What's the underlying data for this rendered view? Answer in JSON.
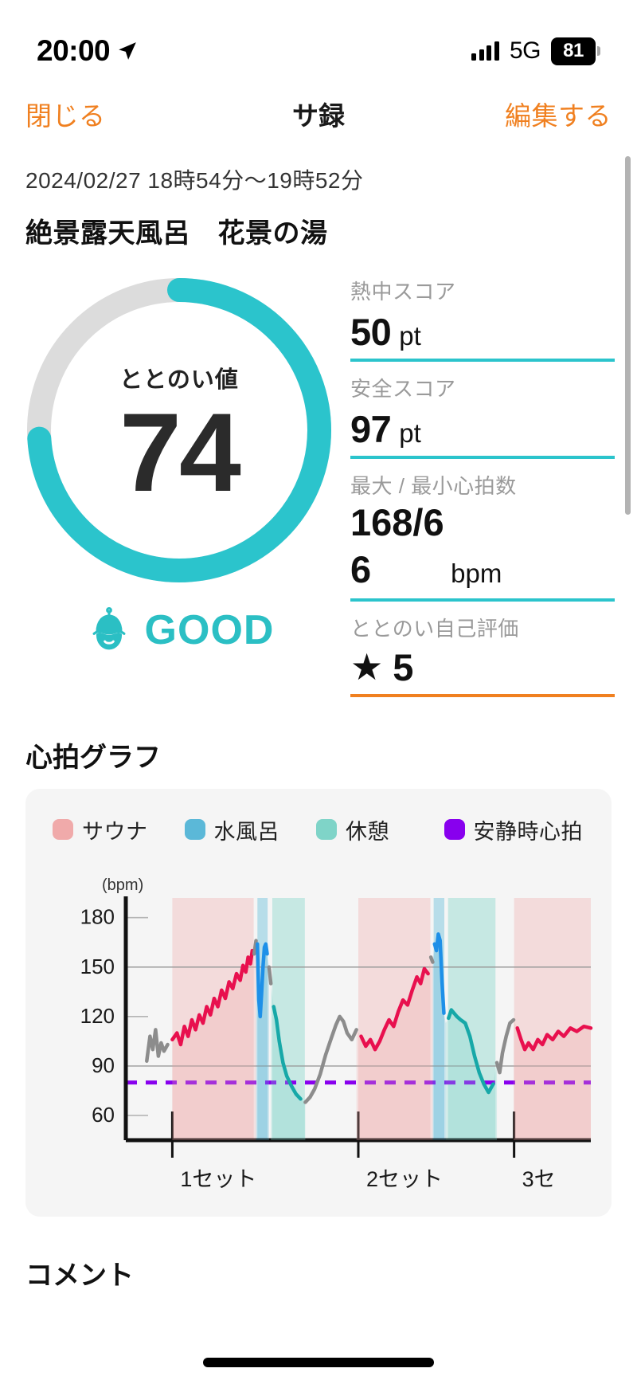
{
  "statusbar": {
    "time": "20:00",
    "location_icon": "location-arrow-icon",
    "signal_icon": "cellular-bars-icon",
    "network": "5G",
    "battery_percent": "81"
  },
  "navbar": {
    "close_label": "閉じる",
    "title": "サ録",
    "edit_label": "編集する"
  },
  "session": {
    "date_range": "2024/02/27 18時54分〜19時52分",
    "venue": "絶景露天風呂　花景の湯"
  },
  "gauge": {
    "label": "ととのい値",
    "value": "74",
    "percent": 74,
    "arc_color": "#2BC4CC",
    "track_color": "#DCDCDC",
    "badge_text": "GOOD",
    "badge_icon": "sauna-hat-face-icon",
    "badge_color": "#2BBFC4"
  },
  "stats": [
    {
      "label": "熱中スコア",
      "value": "50",
      "unit": "pt",
      "accent": "#2BC4CC"
    },
    {
      "label": "安全スコア",
      "value": "97",
      "unit": "pt",
      "accent": "#2BC4CC"
    },
    {
      "label": "最大 / 最小心拍数",
      "value": "168/66",
      "value_line1": "168/6",
      "value_line2": "6",
      "unit": "bpm",
      "accent": "#2BC4CC"
    },
    {
      "label": "ととのい自己評価",
      "star": "★",
      "value": "5",
      "unit": "",
      "accent": "#F08020"
    }
  ],
  "chart_section": {
    "title": "心拍グラフ"
  },
  "comment_section": {
    "title": "コメント"
  },
  "chart_data": {
    "type": "line",
    "title": "心拍グラフ",
    "xlabel": "",
    "ylabel": "(bpm)",
    "ylim": [
      45,
      190
    ],
    "yticks": [
      60,
      90,
      120,
      150,
      180
    ],
    "ytick_labels": [
      "60",
      "90",
      "120",
      "150",
      "180"
    ],
    "gridlines_full": [
      90,
      150
    ],
    "gridlines_short": [
      60,
      120,
      180
    ],
    "xticks": [
      1,
      2,
      3
    ],
    "xtick_labels": [
      "1セット",
      "2セット",
      "3セ"
    ],
    "legend_position": "top",
    "legend": [
      {
        "name": "サウナ",
        "color": "#F0AAAA"
      },
      {
        "name": "水風呂",
        "color": "#5BB8D8"
      },
      {
        "name": "休憩",
        "color": "#7FD4C8"
      },
      {
        "name": "安静時心拍",
        "color": "#8800EE"
      }
    ],
    "resting_hr": {
      "label": "安静時心拍",
      "value": 80,
      "color": "#8800EE",
      "style": "dashed"
    },
    "phase_bands": [
      {
        "type": "サウナ",
        "color": "#F0AAAA",
        "x_start": 0.1,
        "x_end": 0.275
      },
      {
        "type": "水風呂",
        "color": "#5BB8D8",
        "x_start": 0.283,
        "x_end": 0.305
      },
      {
        "type": "休憩",
        "color": "#7FD4C8",
        "x_start": 0.315,
        "x_end": 0.385
      },
      {
        "type": "サウナ",
        "color": "#F0AAAA",
        "x_start": 0.5,
        "x_end": 0.655
      },
      {
        "type": "水風呂",
        "color": "#5BB8D8",
        "x_start": 0.662,
        "x_end": 0.685
      },
      {
        "type": "休憩",
        "color": "#7FD4C8",
        "x_start": 0.693,
        "x_end": 0.795
      },
      {
        "type": "サウナ",
        "color": "#F0AAAA",
        "x_start": 0.835,
        "x_end": 1.0
      }
    ],
    "series": [
      {
        "name": "心拍数",
        "segments": [
          {
            "phase": "移動",
            "color": "#8C8C8C",
            "values": [
              null
            ]
          },
          {
            "phase": "サウナ",
            "color": "#E8104E",
            "values": [
              null
            ]
          },
          {
            "phase": "水風呂",
            "color": "#1E90E8",
            "values": [
              null
            ]
          },
          {
            "phase": "休憩",
            "color": "#17A8A8",
            "values": [
              null
            ]
          }
        ],
        "points": [
          [
            0.045,
            93
          ],
          [
            0.052,
            108
          ],
          [
            0.058,
            100
          ],
          [
            0.064,
            112
          ],
          [
            0.07,
            96
          ],
          [
            0.076,
            104
          ],
          [
            0.082,
            99
          ],
          [
            0.09,
            103
          ],
          [
            0.1,
            106
          ],
          [
            0.11,
            110
          ],
          [
            0.118,
            103
          ],
          [
            0.126,
            114
          ],
          [
            0.134,
            108
          ],
          [
            0.142,
            118
          ],
          [
            0.15,
            112
          ],
          [
            0.158,
            121
          ],
          [
            0.166,
            116
          ],
          [
            0.174,
            126
          ],
          [
            0.182,
            121
          ],
          [
            0.19,
            131
          ],
          [
            0.198,
            126
          ],
          [
            0.206,
            136
          ],
          [
            0.214,
            131
          ],
          [
            0.222,
            141
          ],
          [
            0.23,
            137
          ],
          [
            0.238,
            146
          ],
          [
            0.246,
            142
          ],
          [
            0.252,
            151
          ],
          [
            0.258,
            147
          ],
          [
            0.263,
            156
          ],
          [
            0.268,
            152
          ],
          [
            0.272,
            160
          ],
          [
            0.276,
            158
          ],
          [
            0.28,
            166
          ],
          [
            0.283,
            164
          ],
          [
            0.286,
            130
          ],
          [
            0.289,
            120
          ],
          [
            0.292,
            134
          ],
          [
            0.295,
            150
          ],
          [
            0.298,
            162
          ],
          [
            0.301,
            164
          ],
          [
            0.304,
            158
          ],
          [
            0.308,
            150
          ],
          [
            0.312,
            140
          ],
          [
            0.318,
            126
          ],
          [
            0.324,
            118
          ],
          [
            0.33,
            105
          ],
          [
            0.338,
            92
          ],
          [
            0.346,
            84
          ],
          [
            0.356,
            78
          ],
          [
            0.366,
            73
          ],
          [
            0.376,
            70
          ],
          [
            0.386,
            68
          ],
          [
            0.396,
            71
          ],
          [
            0.406,
            76
          ],
          [
            0.418,
            85
          ],
          [
            0.43,
            97
          ],
          [
            0.442,
            107
          ],
          [
            0.452,
            115
          ],
          [
            0.46,
            120
          ],
          [
            0.468,
            117
          ],
          [
            0.476,
            110
          ],
          [
            0.486,
            106
          ],
          [
            0.496,
            112
          ],
          [
            0.506,
            108
          ],
          [
            0.516,
            102
          ],
          [
            0.526,
            106
          ],
          [
            0.536,
            100
          ],
          [
            0.546,
            105
          ],
          [
            0.556,
            112
          ],
          [
            0.566,
            118
          ],
          [
            0.576,
            114
          ],
          [
            0.586,
            123
          ],
          [
            0.596,
            130
          ],
          [
            0.606,
            127
          ],
          [
            0.616,
            136
          ],
          [
            0.626,
            144
          ],
          [
            0.634,
            140
          ],
          [
            0.642,
            149
          ],
          [
            0.65,
            146
          ],
          [
            0.656,
            156
          ],
          [
            0.66,
            153
          ],
          [
            0.664,
            164
          ],
          [
            0.668,
            160
          ],
          [
            0.672,
            170
          ],
          [
            0.676,
            166
          ],
          [
            0.68,
            141
          ],
          [
            0.684,
            122
          ],
          [
            0.688,
            116
          ],
          [
            0.694,
            119
          ],
          [
            0.7,
            124
          ],
          [
            0.706,
            122
          ],
          [
            0.712,
            120
          ],
          [
            0.72,
            118
          ],
          [
            0.73,
            116
          ],
          [
            0.74,
            108
          ],
          [
            0.75,
            96
          ],
          [
            0.76,
            86
          ],
          [
            0.77,
            79
          ],
          [
            0.78,
            74
          ],
          [
            0.79,
            79
          ],
          [
            0.798,
            92
          ],
          [
            0.804,
            86
          ],
          [
            0.81,
            98
          ],
          [
            0.818,
            108
          ],
          [
            0.826,
            116
          ],
          [
            0.834,
            118
          ],
          [
            0.842,
            113
          ],
          [
            0.85,
            106
          ],
          [
            0.858,
            100
          ],
          [
            0.866,
            104
          ],
          [
            0.876,
            100
          ],
          [
            0.886,
            106
          ],
          [
            0.896,
            103
          ],
          [
            0.906,
            109
          ],
          [
            0.918,
            106
          ],
          [
            0.93,
            111
          ],
          [
            0.942,
            108
          ],
          [
            0.956,
            113
          ],
          [
            0.97,
            111
          ],
          [
            0.985,
            114
          ],
          [
            1.0,
            113
          ]
        ]
      }
    ]
  }
}
